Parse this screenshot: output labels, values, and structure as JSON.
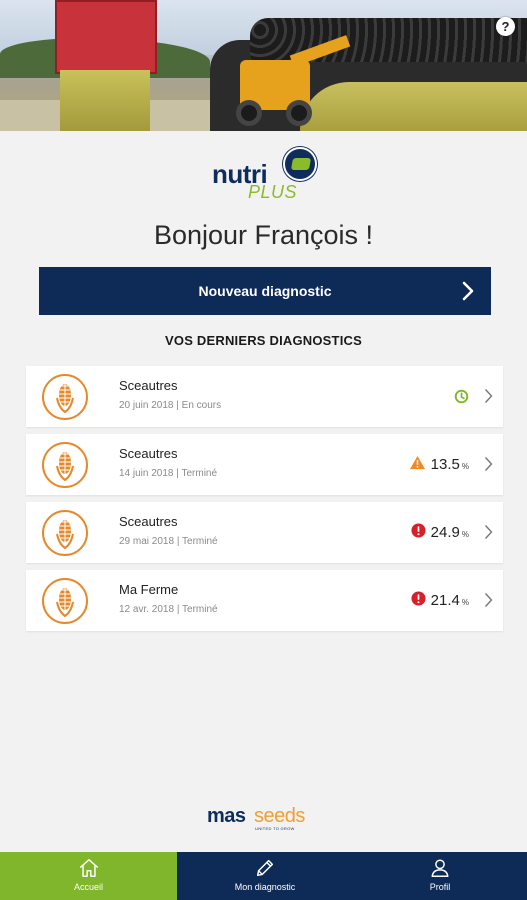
{
  "header": {
    "help_label": "?"
  },
  "logo": {
    "word1": "nutri",
    "word2": "PLUS"
  },
  "greeting": "Bonjour François !",
  "new_diagnostic_button": "Nouveau diagnostic",
  "section_title": "VOS DERNIERS DIAGNOSTICS",
  "diagnostics": [
    {
      "name": "Sceautres",
      "meta": "20 juin 2018 | En cours",
      "status": "in-progress",
      "status_icon": "clock-icon",
      "value": "",
      "unit": ""
    },
    {
      "name": "Sceautres",
      "meta": "14 juin 2018 | Terminé",
      "status": "warning",
      "status_icon": "warning-icon",
      "value": "13.5",
      "unit": "%"
    },
    {
      "name": "Sceautres",
      "meta": "29 mai 2018 | Terminé",
      "status": "alert",
      "status_icon": "alert-icon",
      "value": "24.9",
      "unit": "%"
    },
    {
      "name": "Ma Ferme",
      "meta": "12 avr. 2018 | Terminé",
      "status": "alert",
      "status_icon": "alert-icon",
      "value": "21.4",
      "unit": "%"
    }
  ],
  "brand": {
    "part1": "mas",
    "part2": "seeds",
    "tagline": "UNITED TO GROW"
  },
  "tabs": [
    {
      "label": "Accueil",
      "icon": "home-icon",
      "active": true
    },
    {
      "label": "Mon diagnostic",
      "icon": "pencil-icon",
      "active": false
    },
    {
      "label": "Profil",
      "icon": "user-icon",
      "active": false
    }
  ],
  "colors": {
    "primary_navy": "#0e2a56",
    "accent_green": "#7fb62c",
    "corn_orange": "#e58a2c",
    "warning_orange": "#f08a24",
    "alert_red": "#d81f2a",
    "progress_green": "#7fb62c"
  }
}
